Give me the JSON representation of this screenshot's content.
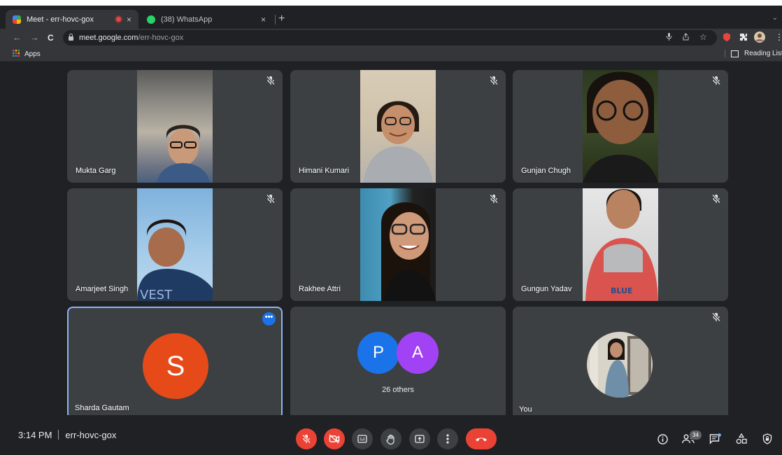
{
  "browser": {
    "tabs": [
      {
        "title": "Meet - err-hovc-gox",
        "active": true,
        "recording": true,
        "close": "×"
      },
      {
        "title": "(38) WhatsApp",
        "active": false,
        "close": "×"
      }
    ],
    "new_tab": "+",
    "nav": {
      "back": "←",
      "forward": "→",
      "reload": "C"
    },
    "url_host": "meet.google.com",
    "url_path": "/err-hovc-gox",
    "bookmarks": {
      "apps_label": "Apps",
      "reading_list_label": "Reading List"
    }
  },
  "meet": {
    "tiles": [
      {
        "name": "Mukta Garg",
        "muted": true
      },
      {
        "name": "Himani Kumari",
        "muted": true
      },
      {
        "name": "Gunjan Chugh",
        "muted": true
      },
      {
        "name": "Amarjeet Singh",
        "muted": true
      },
      {
        "name": "Rakhee Attri",
        "muted": true
      },
      {
        "name": "Gungun Yadav",
        "muted": true
      },
      {
        "name": "Sharda Gautam",
        "avatar_letter": "S",
        "avatar_color": "#e64a19",
        "more_menu": "•••"
      },
      {
        "others_label": "26 others",
        "avatars": [
          {
            "letter": "P",
            "color": "#1a73e8"
          },
          {
            "letter": "A",
            "color": "#a142f4"
          }
        ]
      },
      {
        "name": "You",
        "muted": true
      }
    ],
    "bottom": {
      "time": "3:14 PM",
      "meeting_code": "err-hovc-gox",
      "participant_count": "34"
    },
    "colors": {
      "accent": "#8ab4f8",
      "danger": "#ea4335",
      "tile_bg": "#3c4043"
    }
  }
}
